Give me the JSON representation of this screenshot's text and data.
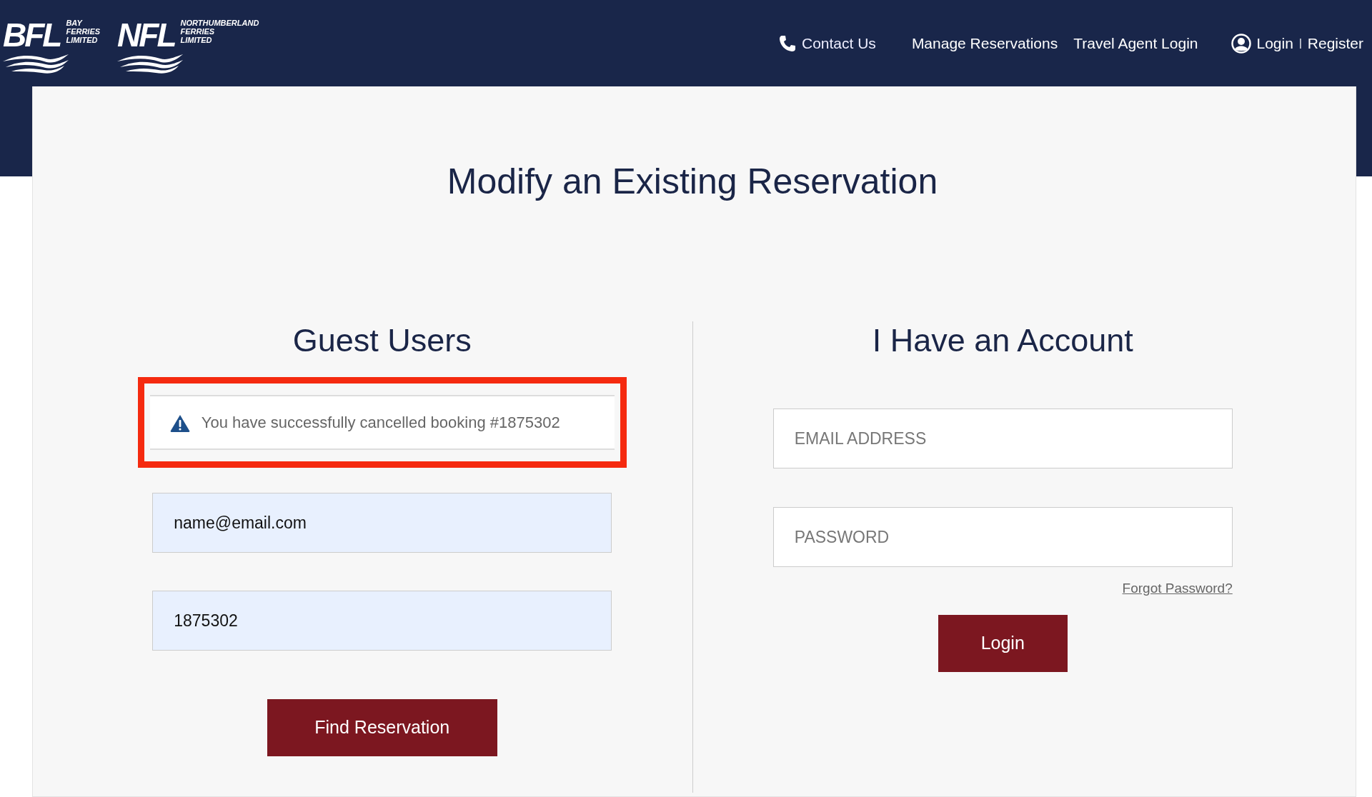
{
  "header": {
    "logos": [
      {
        "letters": "BFL",
        "lines": [
          "BAY",
          "FERRIES",
          "LIMITED"
        ]
      },
      {
        "letters": "NFL",
        "lines": [
          "NORTHUMBERLAND",
          "FERRIES",
          "LIMITED"
        ]
      }
    ],
    "nav": [
      {
        "kind": "phone",
        "label": "Contact Us"
      },
      {
        "kind": "plain",
        "label": "Manage Reservations"
      },
      {
        "kind": "plain",
        "label": "Travel Agent Login"
      }
    ],
    "account": {
      "login": "Login",
      "separator": "|",
      "register": "Register"
    }
  },
  "title": "Modify an Existing Reservation",
  "guest": {
    "heading": "Guest Users",
    "notice": {
      "text": "You have successfully cancelled booking #1875302",
      "highlighted": true
    },
    "fields": [
      {
        "value": "name@email.com"
      },
      {
        "value": "1875302"
      }
    ],
    "button": "Find Reservation"
  },
  "member": {
    "heading": "I Have an Account",
    "fields": [
      {
        "placeholder": "EMAIL ADDRESS"
      },
      {
        "placeholder": "PASSWORD"
      }
    ],
    "forgot": "Forgot Password?",
    "button": "Login"
  }
}
